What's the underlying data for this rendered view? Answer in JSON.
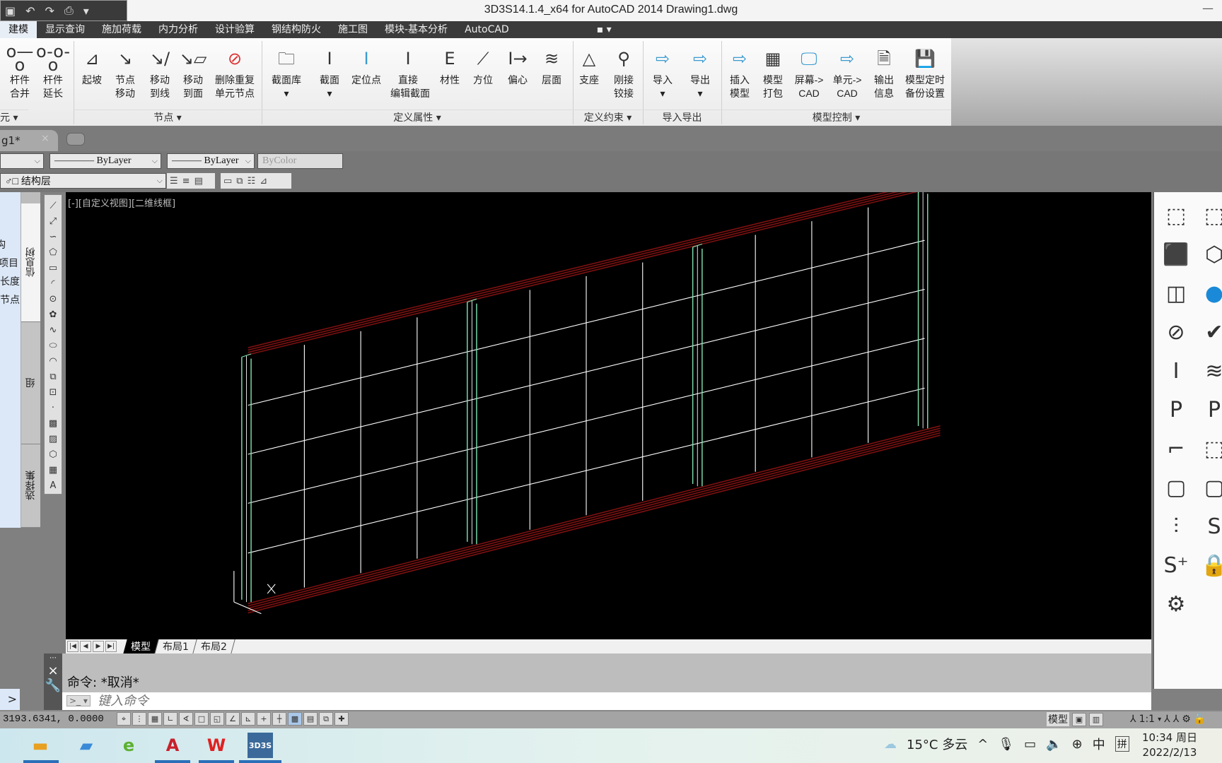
{
  "window": {
    "title": "3D3S14.1.4_x64 for AutoCAD 2014    Drawing1.dwg",
    "minimize": "—"
  },
  "ribbon_tabs": [
    {
      "label": "建模",
      "active": true
    },
    {
      "label": "显示查询"
    },
    {
      "label": "施加荷载"
    },
    {
      "label": "内力分析"
    },
    {
      "label": "设计验算"
    },
    {
      "label": "钢结构防火"
    },
    {
      "label": "施工图"
    },
    {
      "label": "模块-基本分析"
    },
    {
      "label": "AutoCAD"
    }
  ],
  "ribbon_buttons": [
    {
      "label": "杆件\n合并",
      "icon": "merge-member"
    },
    {
      "label": "杆件\n延长",
      "icon": "extend-member"
    },
    {
      "label": "起坡",
      "icon": "slope"
    },
    {
      "label": "节点\n移动",
      "icon": "move-node"
    },
    {
      "label": "移动\n到线",
      "icon": "move-to-line"
    },
    {
      "label": "移动\n到面",
      "icon": "move-to-plane"
    },
    {
      "label": "删除重复\n单元节点",
      "icon": "delete-duplicate"
    },
    {
      "label": "截面库\n▾",
      "icon": "section-library"
    },
    {
      "label": "截面\n▾",
      "icon": "section"
    },
    {
      "label": "定位点",
      "icon": "anchor-point"
    },
    {
      "label": "直接\n编辑截面",
      "icon": "edit-section"
    },
    {
      "label": "材性",
      "icon": "material"
    },
    {
      "label": "方位",
      "icon": "orientation"
    },
    {
      "label": "偏心",
      "icon": "eccentric"
    },
    {
      "label": "层面",
      "icon": "layer-plane"
    },
    {
      "label": "支座",
      "icon": "support"
    },
    {
      "label": "刚接\n铰接",
      "icon": "rigid-hinge"
    },
    {
      "label": "导入\n▾",
      "icon": "import"
    },
    {
      "label": "导出\n▾",
      "icon": "export"
    },
    {
      "label": "插入\n模型",
      "icon": "insert-model"
    },
    {
      "label": "模型\n打包",
      "icon": "pack-model"
    },
    {
      "label": "屏幕->\nCAD",
      "icon": "screen-to-cad"
    },
    {
      "label": "单元->\nCAD",
      "icon": "element-to-cad"
    },
    {
      "label": "输出\n信息",
      "icon": "output-info"
    },
    {
      "label": "模型定时\n备份设置",
      "icon": "backup-settings"
    }
  ],
  "ribbon_panels": [
    "元 ▾",
    "节点 ▾",
    "定义属性 ▾",
    "定义约束 ▾",
    "导入导出",
    "模型控制 ▾"
  ],
  "doc_tab": {
    "label": "g1*",
    "close": "×"
  },
  "properties": {
    "color": "",
    "linetype": "———— ByLayer",
    "lineweight": "——— ByLayer",
    "plotstyle": "ByColor",
    "layer": "♂□ 结构层"
  },
  "viewport_label": "[-][自定义视图][二维线框]",
  "layout_tabs": [
    "模型",
    "布局1",
    "布局2"
  ],
  "left_panel": {
    "items": [
      "构",
      "项目",
      "长度",
      "节点"
    ],
    "tabs": [
      "信息树",
      "组",
      "选择集"
    ],
    "expand": ">"
  },
  "command": {
    "history": "命令:  *取消*",
    "placeholder": "键入命令",
    "close": "×"
  },
  "status": {
    "coords": "3193.6341,  0.0000",
    "model": "模型",
    "scale": "1:1"
  },
  "taskbar": {
    "weather": "15°C  多云",
    "ime1": "中",
    "ime2": "拼",
    "time": "10:34 周日",
    "date": "2022/2/13"
  },
  "colors": {
    "frame": "#ffffff",
    "columns": "#7fe0b0",
    "beams": "#7a1010",
    "drawing_bg": "#000000"
  }
}
